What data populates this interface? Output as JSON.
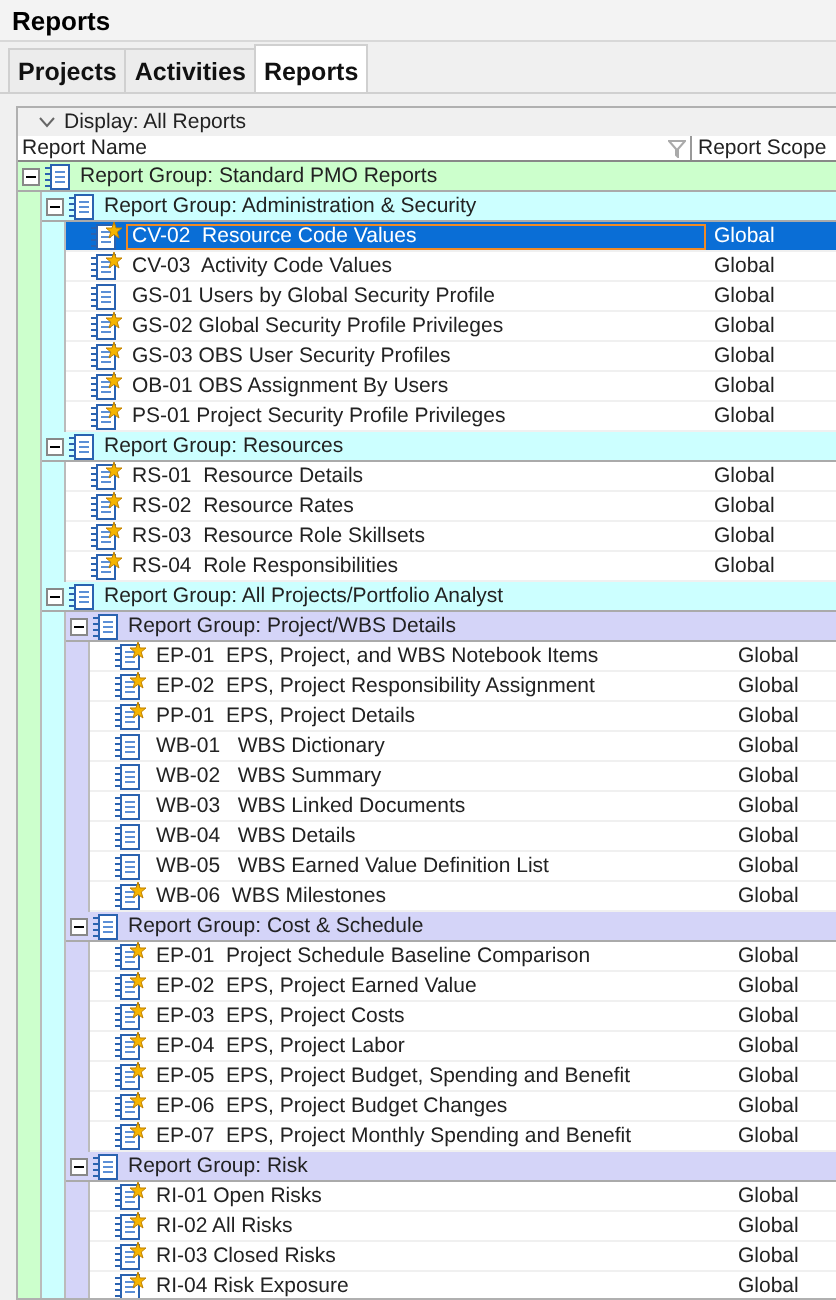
{
  "window": {
    "title": "Reports"
  },
  "tabs": [
    {
      "label": "Projects",
      "selected": false
    },
    {
      "label": "Activities",
      "selected": false
    },
    {
      "label": "Reports",
      "selected": true
    }
  ],
  "display": {
    "label": "Display: All Reports"
  },
  "columns": [
    "Report Name",
    "Report Scope"
  ],
  "tree": [
    {
      "name": "Report Group: Standard PMO Reports",
      "expanded": true,
      "children": [
        {
          "name": "Report Group: Administration & Security",
          "expanded": true,
          "children": [
            {
              "kind": "starred",
              "name": "CV-02  Resource Code Values",
              "scope": "Global",
              "selected": true
            },
            {
              "kind": "starred",
              "name": "CV-03  Activity Code Values",
              "scope": "Global",
              "selected": false
            },
            {
              "kind": "plain",
              "name": "GS-01 Users by Global Security Profile",
              "scope": "Global",
              "selected": false
            },
            {
              "kind": "starred",
              "name": "GS-02 Global Security Profile Privileges",
              "scope": "Global",
              "selected": false
            },
            {
              "kind": "starred",
              "name": "GS-03 OBS User Security Profiles",
              "scope": "Global",
              "selected": false
            },
            {
              "kind": "starred",
              "name": "OB-01 OBS Assignment By Users",
              "scope": "Global",
              "selected": false
            },
            {
              "kind": "starred",
              "name": "PS-01 Project Security Profile Privileges",
              "scope": "Global",
              "selected": false
            }
          ]
        },
        {
          "name": "Report Group: Resources",
          "expanded": true,
          "children": [
            {
              "kind": "starred",
              "name": "RS-01  Resource Details",
              "scope": "Global",
              "selected": false
            },
            {
              "kind": "starred",
              "name": "RS-02  Resource Rates",
              "scope": "Global",
              "selected": false
            },
            {
              "kind": "starred",
              "name": "RS-03  Resource Role Skillsets",
              "scope": "Global",
              "selected": false
            },
            {
              "kind": "starred",
              "name": "RS-04  Role Responsibilities",
              "scope": "Global",
              "selected": false
            }
          ]
        },
        {
          "name": "Report Group: All Projects/Portfolio Analyst",
          "expanded": true,
          "children": [
            {
              "name": "Report Group: Project/WBS Details",
              "expanded": true,
              "children": [
                {
                  "kind": "starred",
                  "name": "EP-01  EPS, Project, and WBS Notebook Items",
                  "scope": "Global",
                  "selected": false
                },
                {
                  "kind": "starred",
                  "name": "EP-02  EPS, Project Responsibility Assignment",
                  "scope": "Global",
                  "selected": false
                },
                {
                  "kind": "starred",
                  "name": "PP-01  EPS, Project Details",
                  "scope": "Global",
                  "selected": false
                },
                {
                  "kind": "plain",
                  "name": "WB-01   WBS Dictionary",
                  "scope": "Global",
                  "selected": false
                },
                {
                  "kind": "plain",
                  "name": "WB-02   WBS Summary",
                  "scope": "Global",
                  "selected": false
                },
                {
                  "kind": "plain",
                  "name": "WB-03   WBS Linked Documents",
                  "scope": "Global",
                  "selected": false
                },
                {
                  "kind": "plain",
                  "name": "WB-04   WBS Details",
                  "scope": "Global",
                  "selected": false
                },
                {
                  "kind": "plain",
                  "name": "WB-05   WBS Earned Value Definition List",
                  "scope": "Global",
                  "selected": false
                },
                {
                  "kind": "starred",
                  "name": "WB-06  WBS Milestones",
                  "scope": "Global",
                  "selected": false
                }
              ]
            },
            {
              "name": "Report Group: Cost & Schedule",
              "expanded": true,
              "children": [
                {
                  "kind": "starred",
                  "name": "EP-01  Project Schedule Baseline Comparison",
                  "scope": "Global",
                  "selected": false
                },
                {
                  "kind": "starred",
                  "name": "EP-02  EPS, Project Earned Value",
                  "scope": "Global",
                  "selected": false
                },
                {
                  "kind": "starred",
                  "name": "EP-03  EPS, Project Costs",
                  "scope": "Global",
                  "selected": false
                },
                {
                  "kind": "starred",
                  "name": "EP-04  EPS, Project Labor",
                  "scope": "Global",
                  "selected": false
                },
                {
                  "kind": "starred",
                  "name": "EP-05  EPS, Project Budget, Spending and Benefit",
                  "scope": "Global",
                  "selected": false
                },
                {
                  "kind": "starred",
                  "name": "EP-06  EPS, Project Budget Changes",
                  "scope": "Global",
                  "selected": false
                },
                {
                  "kind": "starred",
                  "name": "EP-07  EPS, Project Monthly Spending and Benefit",
                  "scope": "Global",
                  "selected": false
                }
              ]
            },
            {
              "name": "Report Group: Risk",
              "expanded": true,
              "children": [
                {
                  "kind": "starred",
                  "name": "RI-01 Open Risks",
                  "scope": "Global",
                  "selected": false
                },
                {
                  "kind": "starred",
                  "name": "RI-02 All Risks",
                  "scope": "Global",
                  "selected": false
                },
                {
                  "kind": "starred",
                  "name": "RI-03 Closed Risks",
                  "scope": "Global",
                  "selected": false
                },
                {
                  "kind": "starred",
                  "name": "RI-04 Risk Exposure",
                  "scope": "Global",
                  "selected": false
                }
              ]
            }
          ]
        }
      ]
    }
  ]
}
